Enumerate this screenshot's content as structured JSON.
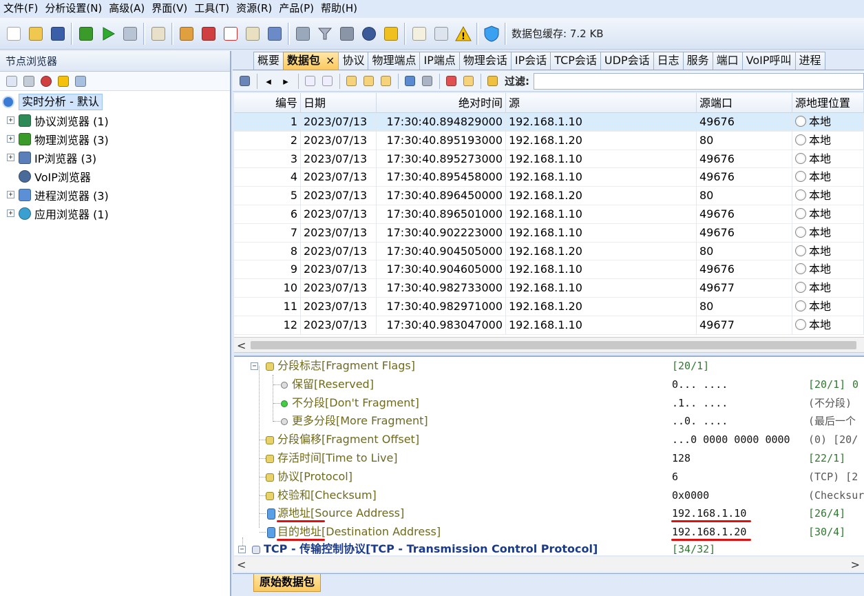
{
  "menu": [
    "文件(F)",
    "分析设置(N)",
    "高级(A)",
    "界面(V)",
    "工具(T)",
    "资源(R)",
    "产品(P)",
    "帮助(H)"
  ],
  "toolbar": {
    "buttons": [
      "new-file",
      "open-folder",
      "save",
      "network-adapter",
      "start",
      "stop",
      "filter-settings",
      "gear-settings",
      "nodes",
      "add-document",
      "packet-list",
      "network-map",
      "trash",
      "funnel-filter",
      "print",
      "refresh",
      "export",
      "edit",
      "copy",
      "warning",
      "shield"
    ],
    "cache_label": "数据包缓存: 7.2 KB"
  },
  "node_browser": {
    "title": "节点浏览器",
    "root": "实时分析 - 默认",
    "items": [
      {
        "label": "协议浏览器 (1)",
        "expandable": true,
        "color": "#2e8b57"
      },
      {
        "label": "物理浏览器 (3)",
        "expandable": true,
        "color": "#3a9a2a"
      },
      {
        "label": "IP浏览器 (3)",
        "expandable": true,
        "color": "#5a7fb8"
      },
      {
        "label": "VoIP浏览器",
        "expandable": false,
        "color": "#4a6a9a"
      },
      {
        "label": "进程浏览器 (3)",
        "expandable": true,
        "color": "#5b8fd6"
      },
      {
        "label": "应用浏览器 (1)",
        "expandable": true,
        "color": "#3aa0d0"
      }
    ]
  },
  "tabs": [
    "概要",
    "数据包",
    "协议",
    "物理端点",
    "IP端点",
    "物理会话",
    "IP会话",
    "TCP会话",
    "UDP会话",
    "日志",
    "服务",
    "端口",
    "VoIP呼叫",
    "进程"
  ],
  "active_tab": "数据包",
  "close_symbol": "×",
  "filter": {
    "label": "过滤:",
    "value": ""
  },
  "packet_table": {
    "columns": [
      "编号",
      "日期",
      "绝对时间",
      "源",
      "源端口",
      "源地理位置"
    ],
    "rows": [
      {
        "no": "1",
        "date": "2023/07/13",
        "time": "17:30:40.894829000",
        "src": "192.168.1.10",
        "port": "49676",
        "geo": "本地"
      },
      {
        "no": "2",
        "date": "2023/07/13",
        "time": "17:30:40.895193000",
        "src": "192.168.1.20",
        "port": "80",
        "geo": "本地"
      },
      {
        "no": "3",
        "date": "2023/07/13",
        "time": "17:30:40.895273000",
        "src": "192.168.1.10",
        "port": "49676",
        "geo": "本地"
      },
      {
        "no": "4",
        "date": "2023/07/13",
        "time": "17:30:40.895458000",
        "src": "192.168.1.10",
        "port": "49676",
        "geo": "本地"
      },
      {
        "no": "5",
        "date": "2023/07/13",
        "time": "17:30:40.896450000",
        "src": "192.168.1.20",
        "port": "80",
        "geo": "本地"
      },
      {
        "no": "6",
        "date": "2023/07/13",
        "time": "17:30:40.896501000",
        "src": "192.168.1.10",
        "port": "49676",
        "geo": "本地"
      },
      {
        "no": "7",
        "date": "2023/07/13",
        "time": "17:30:40.902223000",
        "src": "192.168.1.10",
        "port": "49676",
        "geo": "本地"
      },
      {
        "no": "8",
        "date": "2023/07/13",
        "time": "17:30:40.904505000",
        "src": "192.168.1.20",
        "port": "80",
        "geo": "本地"
      },
      {
        "no": "9",
        "date": "2023/07/13",
        "time": "17:30:40.904605000",
        "src": "192.168.1.10",
        "port": "49676",
        "geo": "本地"
      },
      {
        "no": "10",
        "date": "2023/07/13",
        "time": "17:30:40.982733000",
        "src": "192.168.1.10",
        "port": "49677",
        "geo": "本地"
      },
      {
        "no": "11",
        "date": "2023/07/13",
        "time": "17:30:40.982971000",
        "src": "192.168.1.20",
        "port": "80",
        "geo": "本地"
      },
      {
        "no": "12",
        "date": "2023/07/13",
        "time": "17:30:40.983047000",
        "src": "192.168.1.10",
        "port": "49677",
        "geo": "本地"
      }
    ],
    "selected_row": 1
  },
  "scroll": {
    "left": "<",
    "right": ">"
  },
  "detail": {
    "rows": [
      {
        "label": "分段标志[Fragment Flags]",
        "value": "",
        "offset": "[20/1]",
        "note": ""
      },
      {
        "label": "保留[Reserved]",
        "value": "0... ....",
        "offset": "[20/1]",
        "note": "0"
      },
      {
        "label": "不分段[Don't Fragment]",
        "value": ".1.. ....",
        "offset": "",
        "note": "(不分段)"
      },
      {
        "label": "更多分段[More Fragment]",
        "value": "..0. ....",
        "offset": "",
        "note": "(最后一个"
      },
      {
        "label": "分段偏移[Fragment Offset]",
        "value": "...0 0000 0000 0000",
        "offset": "",
        "note": "(0)  [20/"
      },
      {
        "label": "存活时间[Time to Live]",
        "value": "128",
        "offset": "[22/1]",
        "note": ""
      },
      {
        "label": "协议[Protocol]",
        "value": "6",
        "offset": "",
        "note": "(TCP)  [2"
      },
      {
        "label": "校验和[Checksum]",
        "value": "0x0000",
        "offset": "",
        "note": "(Checksur"
      },
      {
        "label": "源地址[Source Address]",
        "value": "192.168.1.10",
        "offset": "[26/4]",
        "note": ""
      },
      {
        "label": "目的地址[Destination Address]",
        "value": "192.168.1.20",
        "offset": "[30/4]",
        "note": ""
      },
      {
        "label": "TCP - 传输控制协议[TCP - Transmission Control Protocol]",
        "value": "",
        "offset": "[34/32]",
        "note": ""
      }
    ]
  },
  "bottom_tab": "原始数据包",
  "colors": {
    "accent_tab": "#fbc95e",
    "selected_row": "#d9ecfc",
    "highlight_underline": "#e01010",
    "detail_label": "#6f6a1c"
  }
}
